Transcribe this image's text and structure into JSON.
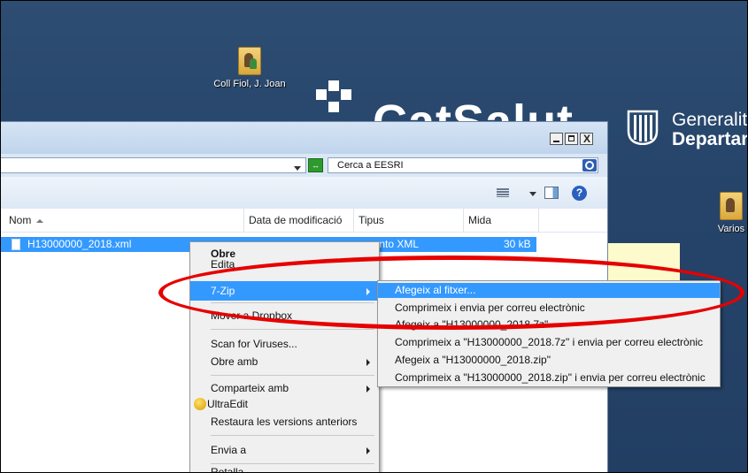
{
  "desktop": {
    "icons": [
      {
        "label": "Coll Fiol, J. Joan"
      },
      {
        "label": "Varios"
      }
    ],
    "catsalut_text": "CatSalut",
    "gencat_line1": "Generalit",
    "gencat_line2": "Departar"
  },
  "window": {
    "controls": {
      "minimize": "_",
      "maximize": "□",
      "close": "X"
    },
    "search_placeholder": "Cerca a EESRI",
    "toolbar": {
      "help_glyph": "?"
    },
    "columns": [
      {
        "label": "Nom"
      },
      {
        "label": "Data de modificació"
      },
      {
        "label": "Tipus"
      },
      {
        "label": "Mida"
      }
    ],
    "files": [
      {
        "name": "H13000000_2018.xml",
        "type": "umento XML",
        "size": "30 kB",
        "selected": true
      }
    ]
  },
  "context_menu": {
    "items": [
      {
        "label": "Obre",
        "bold": true
      },
      {
        "label": "Edita"
      },
      {
        "label": "7-Zip",
        "submenu": true,
        "highlighted": true
      },
      {
        "label": "Mover a Dropbox"
      },
      {
        "label": "Scan for Viruses..."
      },
      {
        "label": "Obre amb",
        "submenu": true
      },
      {
        "label": "Comparteix amb",
        "submenu": true
      },
      {
        "label": "UltraEdit",
        "icon": "ultraedit-icon"
      },
      {
        "label": "Restaura les versions anteriors"
      },
      {
        "label": "Envia a",
        "submenu": true
      },
      {
        "label": "Retalla"
      }
    ]
  },
  "zip_submenu": {
    "items": [
      {
        "label": "Afegeix al fitxer...",
        "highlighted": true
      },
      {
        "label": "Comprimeix i envia per correu electrònic"
      },
      {
        "label": "Afegeix a \"H13000000_2018.7z\""
      },
      {
        "label": "Comprimeix a \"H13000000_2018.7z\" i envia per correu electrònic"
      },
      {
        "label": "Afegeix a \"H13000000_2018.zip\""
      },
      {
        "label": "Comprimeix a \"H13000000_2018.zip\" i envia per correu electrònic"
      }
    ]
  },
  "colors": {
    "selection": "#3399ff",
    "annotation": "#e60000",
    "desktop": "#26446a"
  }
}
